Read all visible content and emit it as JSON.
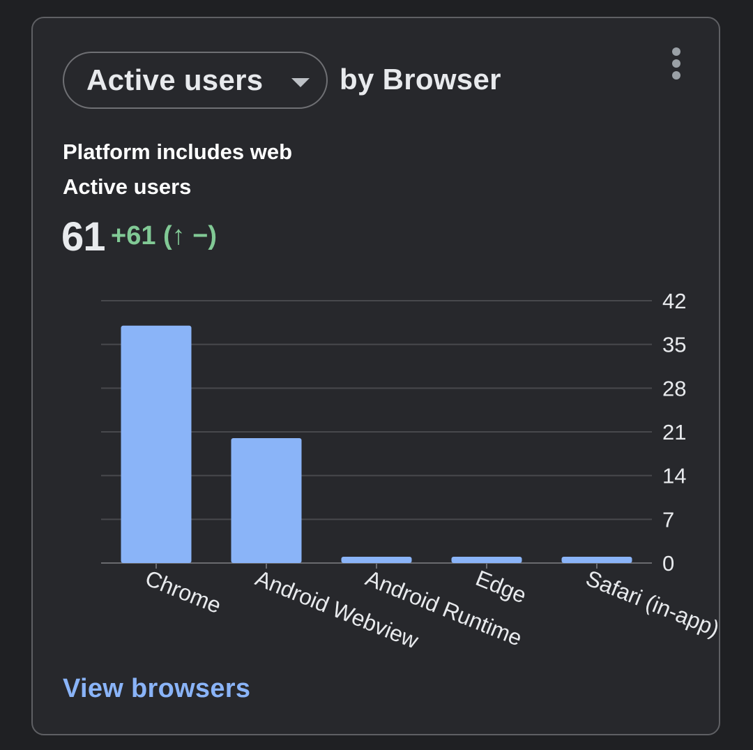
{
  "card": {
    "metric_selector": "Active users",
    "dimension_label": "by Browser",
    "more_options_icon": "more-vert-icon",
    "filter_label": "Platform includes web",
    "metric_label": "Active users",
    "total_value": "61",
    "change_text": "+61 (↑ −)",
    "view_link": "View browsers"
  },
  "colors": {
    "bar": "#8ab4f8",
    "positive_change": "#81c995",
    "link": "#8ab4f8"
  },
  "chart_data": {
    "type": "bar",
    "categories": [
      "Chrome",
      "Android Webview",
      "Android Runtime",
      "Edge",
      "Safari (in-app)"
    ],
    "values": [
      38,
      20,
      1,
      1,
      1
    ],
    "ylim": [
      0,
      42
    ],
    "yticks": [
      0,
      7,
      14,
      21,
      28,
      35,
      42
    ],
    "grid": true,
    "y_axis_position": "right"
  }
}
